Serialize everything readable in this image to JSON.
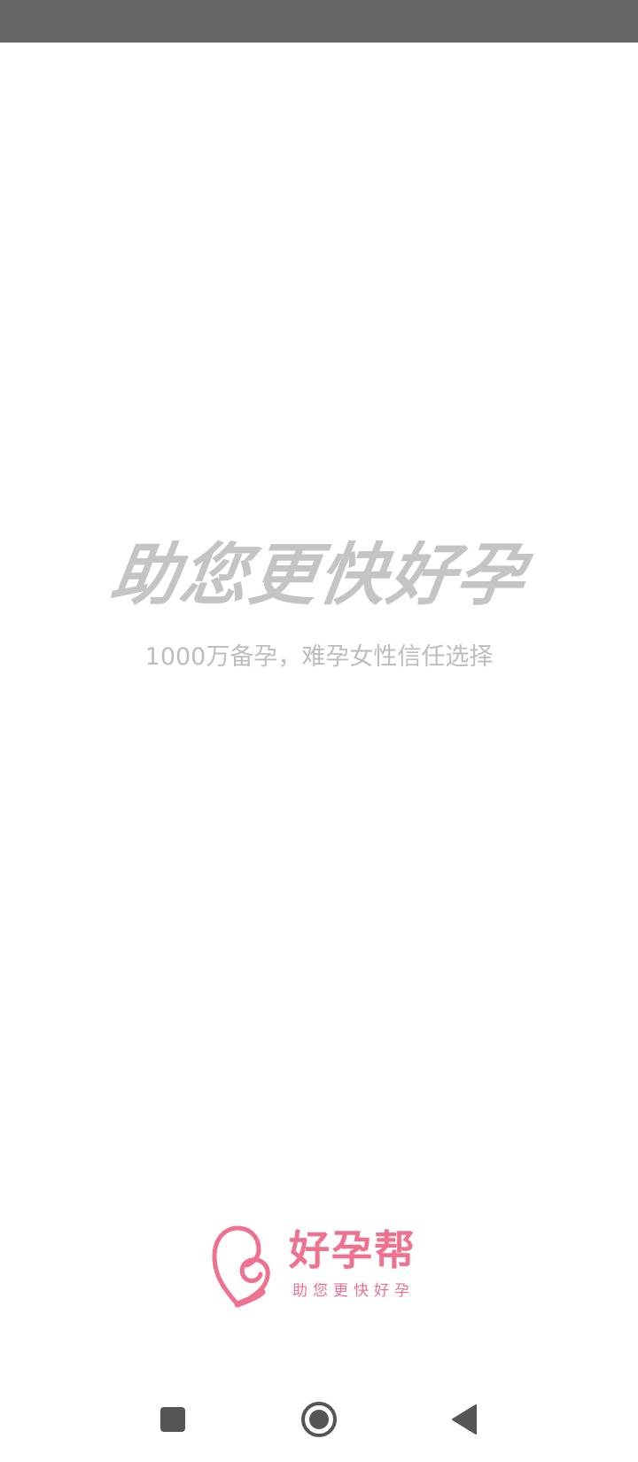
{
  "splash": {
    "slogan": "助您更快好孕",
    "subtitle": "1000万备孕，难孕女性信任选择"
  },
  "brand": {
    "name": "好孕帮",
    "tagline": "助您更快好孕",
    "logo_icon": "heart-baby-logo-icon",
    "color": "#f0708f"
  },
  "nav": {
    "recent_icon": "square-recent-apps-icon",
    "home_icon": "circle-home-icon",
    "back_icon": "triangle-back-icon"
  },
  "colors": {
    "status_bar": "#666666",
    "slogan": "#c4c4c4",
    "subtitle": "#bdbdbd",
    "nav_icons": "#555555"
  }
}
